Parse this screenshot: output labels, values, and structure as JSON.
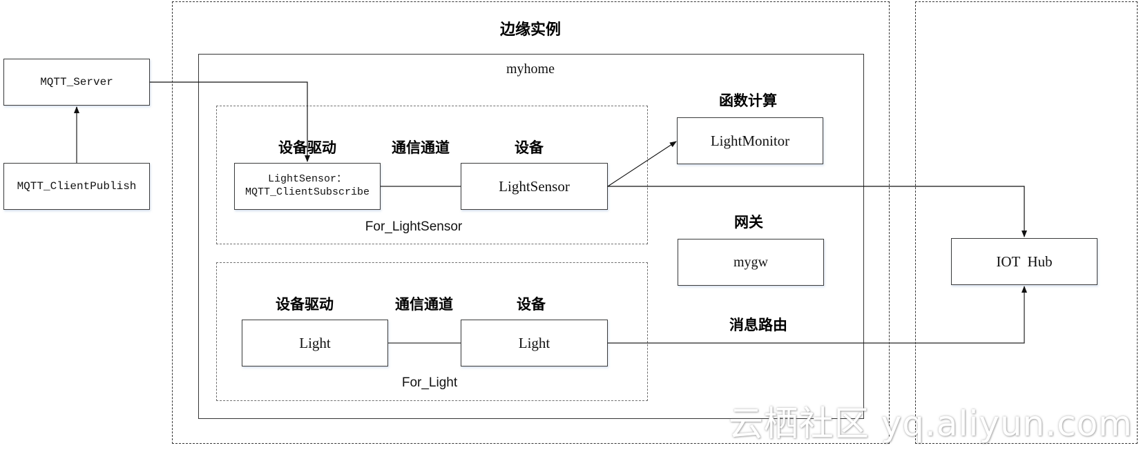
{
  "diagram": {
    "edge_instance": {
      "title": "边缘实例",
      "core": {
        "name": "myhome",
        "groups": [
          {
            "id": "for_lightsensor",
            "label": "For_LightSensor",
            "column_headings": {
              "driver": "设备驱动",
              "channel": "通信通道",
              "device": "设备"
            },
            "driver": "LightSensor：\nMQTT_ClientSubscribe",
            "device": "LightSensor"
          },
          {
            "id": "for_light",
            "label": "For_Light",
            "column_headings": {
              "driver": "设备驱动",
              "channel": "通信通道",
              "device": "设备"
            },
            "driver": "Light",
            "device": "Light"
          }
        ],
        "function_compute": {
          "heading": "函数计算",
          "node": "LightMonitor"
        },
        "gateway": {
          "heading": "网关",
          "node": "mygw"
        },
        "message_routing": {
          "heading": "消息路由"
        }
      }
    },
    "external": {
      "mqtt_server": "MQTT_Server",
      "mqtt_client_publish": "MQTT_ClientPublish"
    },
    "cloud": {
      "iot_hub": "IOT  Hub"
    },
    "edges": [
      {
        "from": "mqtt_client_publish",
        "to": "mqtt_server",
        "arrow": "end"
      },
      {
        "from": "mqtt_server",
        "to": "lightsensor_driver",
        "arrow": "end"
      },
      {
        "from": "lightsensor_driver",
        "to": "lightsensor_device",
        "arrow": "none"
      },
      {
        "from": "lightsensor_device",
        "to": "light_monitor",
        "arrow": "end"
      },
      {
        "from": "lightsensor_device",
        "to": "iot_hub",
        "arrow": "end"
      },
      {
        "from": "light_driver",
        "to": "light_device",
        "arrow": "none"
      },
      {
        "from": "light_device",
        "to": "iot_hub",
        "arrow": "end"
      }
    ]
  },
  "watermark": "云栖社区 yq.aliyun.com"
}
